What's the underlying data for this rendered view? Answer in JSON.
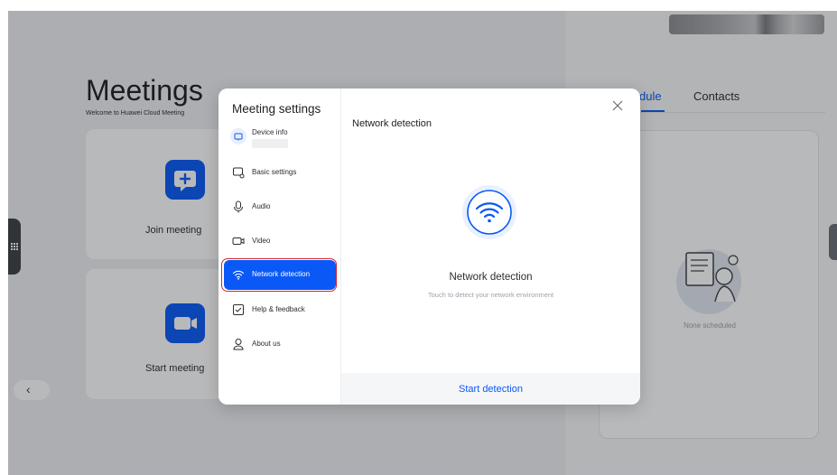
{
  "background": {
    "title": "Meetings",
    "welcome": "Welcome to Huawei Cloud Meeting",
    "tiles": {
      "join_label": "Join meeting",
      "start_label": "Start meeting"
    },
    "right_panel": {
      "tab_schedule": "dule",
      "tab_contacts": "Contacts",
      "empty_text": "None scheduled"
    }
  },
  "dialog": {
    "title": "Meeting settings",
    "menu": [
      {
        "label": "Device info",
        "icon": "device-icon"
      },
      {
        "label": "Basic settings",
        "icon": "settings-icon"
      },
      {
        "label": "Audio",
        "icon": "microphone-icon"
      },
      {
        "label": "Video",
        "icon": "camera-icon"
      },
      {
        "label": "Network detection",
        "icon": "wifi-icon",
        "selected": true
      },
      {
        "label": "Help & feedback",
        "icon": "feedback-icon"
      },
      {
        "label": "About us",
        "icon": "user-icon"
      }
    ],
    "main": {
      "title": "Network detection",
      "center_title": "Network detection",
      "center_subtitle": "Touch to detect your network environment",
      "start_button": "Start detection"
    }
  },
  "colors": {
    "accent": "#0a59f7",
    "highlight_border": "#d0282f"
  }
}
